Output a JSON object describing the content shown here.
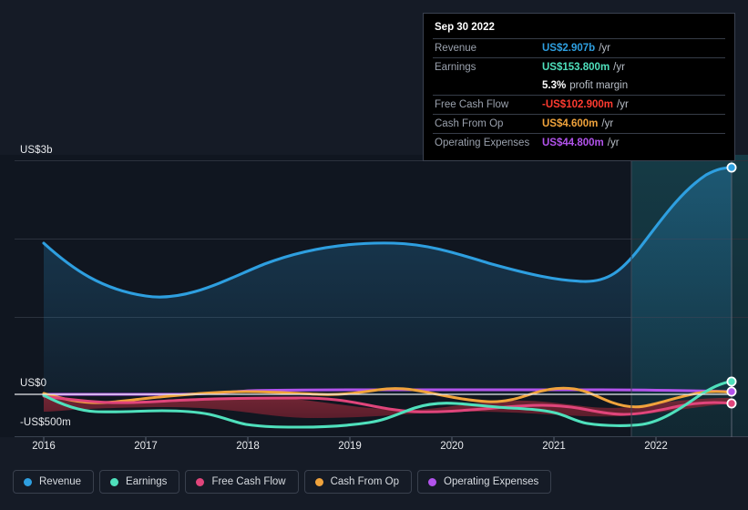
{
  "tooltip": {
    "date": "Sep 30 2022",
    "rows": [
      {
        "key": "Revenue",
        "value": "US$2.907b",
        "suffix": "/yr",
        "color": "#2e9fe0"
      },
      {
        "key": "Earnings",
        "value": "US$153.800m",
        "suffix": "/yr",
        "color": "#4fe0bc"
      },
      {
        "key": "",
        "value": "5.3%",
        "note": "profit margin",
        "color": "#ffffff"
      },
      {
        "key": "Free Cash Flow",
        "value": "-US$102.900m",
        "suffix": "/yr",
        "color": "#ff3b30"
      },
      {
        "key": "Cash From Op",
        "value": "US$4.600m",
        "suffix": "/yr",
        "color": "#f0a33c"
      },
      {
        "key": "Operating Expenses",
        "value": "US$44.800m",
        "suffix": "/yr",
        "color": "#b253ec"
      }
    ]
  },
  "legend": [
    {
      "label": "Revenue",
      "color": "#2e9fe0"
    },
    {
      "label": "Earnings",
      "color": "#4fe0bc"
    },
    {
      "label": "Free Cash Flow",
      "color": "#e0457b"
    },
    {
      "label": "Cash From Op",
      "color": "#f0a33c"
    },
    {
      "label": "Operating Expenses",
      "color": "#b253ec"
    }
  ],
  "axis": {
    "y_top": "US$3b",
    "y_zero": "US$0",
    "y_bottom": "-US$500m",
    "x_ticks": [
      "2016",
      "2017",
      "2018",
      "2019",
      "2020",
      "2021",
      "2022"
    ]
  },
  "chart_data": {
    "type": "line",
    "title": "",
    "xlabel": "",
    "ylabel": "",
    "ylim": [
      -500000000,
      3000000000
    ],
    "y_ticks": [
      3000000000,
      0,
      -500000000
    ],
    "y_tick_labels": [
      "US$3b",
      "US$0",
      "-US$500m"
    ],
    "gridlines": [
      3000000000,
      2000000000,
      1000000000,
      0
    ],
    "grid": true,
    "legend_position": "bottom-left",
    "x": [
      "2016",
      "2016.5",
      "2017",
      "2017.5",
      "2018",
      "2018.5",
      "2019",
      "2019.5",
      "2020",
      "2020.5",
      "2021",
      "2021.5",
      "2022",
      "2022.75"
    ],
    "forecast_boundary": "2021.85",
    "units": "USD",
    "series": [
      {
        "name": "Revenue",
        "color": "#2e9fe0",
        "values": [
          1.94,
          1.52,
          1.26,
          1.4,
          1.58,
          1.78,
          1.92,
          1.92,
          1.82,
          1.7,
          1.6,
          1.63,
          2.15,
          2.907
        ],
        "value_unit": "billions",
        "last_value_label": "US$2.907b"
      },
      {
        "name": "Earnings",
        "color": "#4fe0bc",
        "values": [
          -0.02,
          -0.17,
          -0.21,
          -0.22,
          -0.35,
          -0.35,
          -0.32,
          -0.09,
          -0.1,
          -0.06,
          -0.1,
          -0.24,
          -0.23,
          0.1538
        ],
        "value_unit": "billions",
        "last_value_label": "US$153.800m"
      },
      {
        "name": "Free Cash Flow",
        "color": "#e0457b",
        "values": [
          -0.01,
          -0.07,
          -0.08,
          -0.05,
          -0.03,
          -0.03,
          -0.04,
          -0.12,
          -0.15,
          -0.11,
          -0.06,
          -0.08,
          -0.13,
          -0.1029
        ],
        "value_unit": "billions",
        "last_value_label": "-US$102.900m"
      },
      {
        "name": "Cash From Op",
        "color": "#f0a33c",
        "values": [
          0.01,
          -0.05,
          -0.05,
          -0.02,
          0.02,
          0.03,
          0.01,
          -0.04,
          -0.03,
          0.04,
          0.02,
          -0.06,
          -0.02,
          0.0046
        ],
        "value_unit": "billions",
        "last_value_label": "US$4.600m"
      },
      {
        "name": "Operating Expenses",
        "color": "#b253ec",
        "values": [
          0.0,
          0.0,
          0.0,
          0.0,
          0.02,
          0.03,
          0.03,
          0.03,
          0.035,
          0.04,
          0.04,
          0.04,
          0.042,
          0.0448
        ],
        "value_unit": "billions",
        "last_value_label": "US$44.800m"
      }
    ]
  }
}
